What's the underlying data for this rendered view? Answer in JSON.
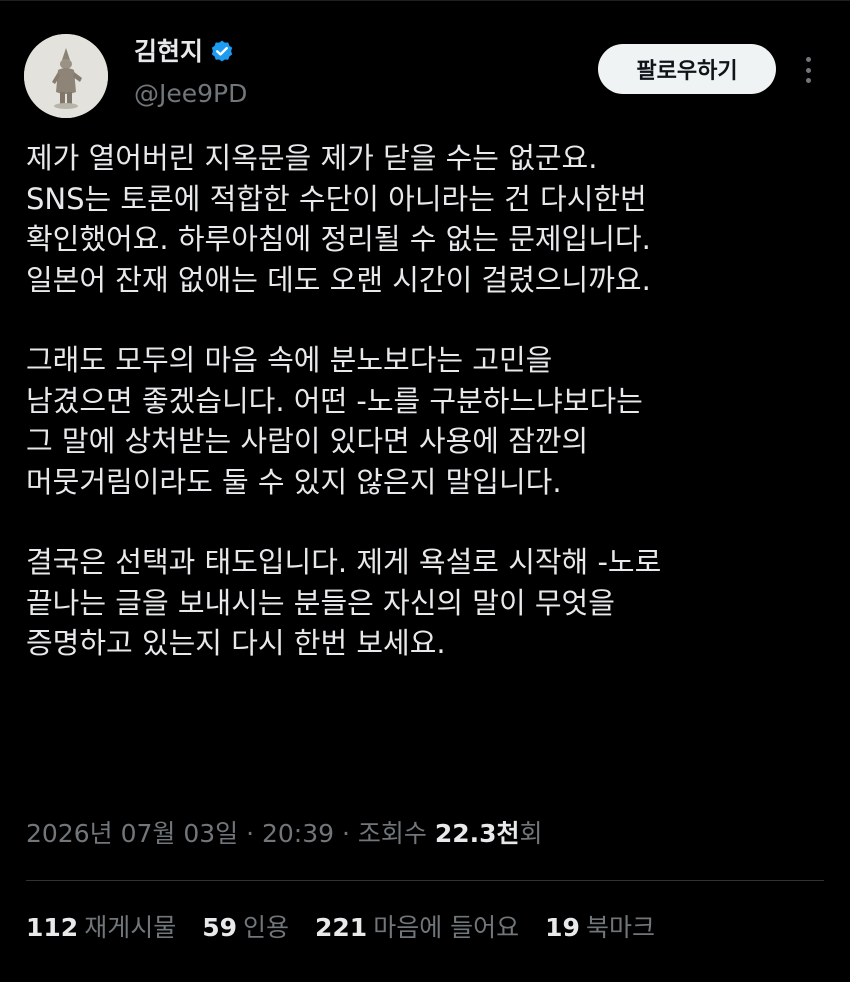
{
  "author": {
    "name": "김현지",
    "handle": "@Jee9PD",
    "verified_color": "#1d9bf0"
  },
  "follow_button": {
    "label": "팔로우하기"
  },
  "more_icon": "more-vertical-icon",
  "tweet": {
    "paragraphs": [
      [
        "제가 열어버린 지옥문을 제가 닫을 수는 없군요.",
        "SNS는 토론에 적합한 수단이 아니라는 건 다시한번",
        "확인했어요. 하루아침에 정리될 수 없는 문제입니다.",
        "일본어 잔재 없애는 데도 오랜 시간이 걸렸으니까요."
      ],
      [
        "그래도 모두의 마음 속에 분노보다는 고민을",
        "남겼으면 좋겠습니다. 어떤 -노를 구분하느냐보다는",
        "그 말에 상처받는 사람이 있다면 사용에 잠깐의",
        "머뭇거림이라도 둘 수 있지 않은지 말입니다."
      ],
      [
        "결국은 선택과 태도입니다. 제게 욕설로 시작해 -노로",
        "끝나는 글을 보내시는 분들은 자신의 말이 무엇을",
        "증명하고 있는지 다시 한번 보세요."
      ]
    ]
  },
  "meta": {
    "date_time": "2026년 07월 03일 · 20:39 · 조회수 ",
    "views_count": "22.3천",
    "views_unit": "회"
  },
  "stats": {
    "reposts": {
      "count": "112",
      "label": "재게시물"
    },
    "quotes": {
      "count": "59",
      "label": "인용"
    },
    "likes": {
      "count": "221",
      "label": "마음에 들어요"
    },
    "bookmarks": {
      "count": "19",
      "label": "북마크"
    }
  }
}
